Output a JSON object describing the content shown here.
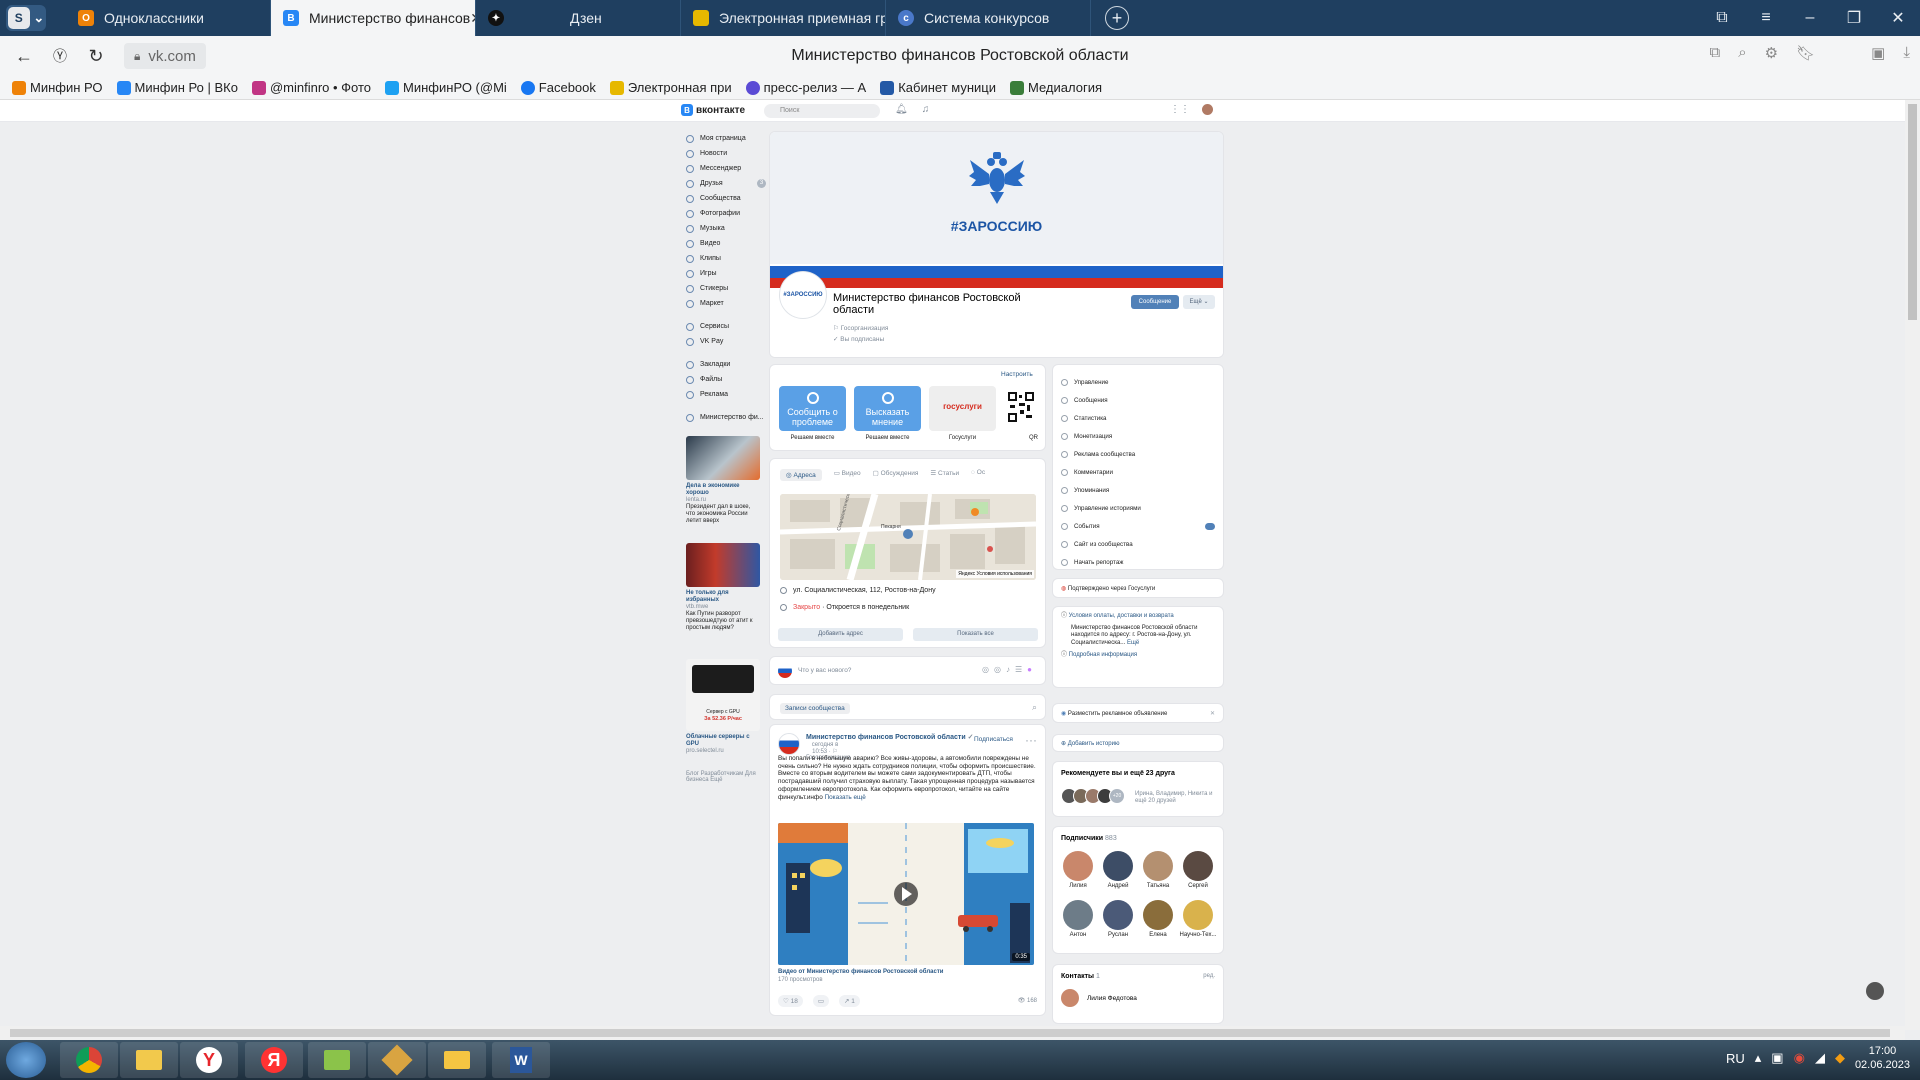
{
  "browser": {
    "tabs": [
      {
        "label": "Одноклассники",
        "icon": "ok-icon",
        "color": "#ee8208"
      },
      {
        "label": "Министерство финансов",
        "icon": "vk-icon",
        "color": "#2787f5",
        "active": true
      },
      {
        "label": "Дзен",
        "icon": "dzen-icon",
        "color": "#111111"
      },
      {
        "label": "Электронная приемная гр",
        "icon": "folder-icon",
        "color": "#e6b800"
      },
      {
        "label": "Система конкурсов",
        "icon": "contest-icon",
        "color": "#4a78c9"
      }
    ],
    "logo_letter": "S",
    "url": "vk.com",
    "page_title": "Министерство финансов Ростовской области",
    "bookmarks": [
      {
        "label": "Минфин РО",
        "color": "#ee8208"
      },
      {
        "label": "Минфин Ро | ВКо",
        "color": "#2787f5"
      },
      {
        "label": "@minfinro • Фото",
        "color": "#c13584"
      },
      {
        "label": "МинфинРО (@Mi",
        "color": "#1da1f2"
      },
      {
        "label": "Facebook",
        "color": "#1877f2"
      },
      {
        "label": "Электронная при",
        "color": "#e6b800"
      },
      {
        "label": "пресс-релиз — А",
        "color": "#5b4bd5"
      },
      {
        "label": "Кабинет муници",
        "color": "#2459a6"
      },
      {
        "label": "Медиалогия",
        "color": "#3a7d3a"
      }
    ]
  },
  "vk": {
    "logo": "вконтакте",
    "search_placeholder": "Поиск",
    "menu": [
      {
        "label": "Моя страница"
      },
      {
        "label": "Новости"
      },
      {
        "label": "Мессенджер"
      },
      {
        "label": "Друзья",
        "badge": "3"
      },
      {
        "label": "Сообщества"
      },
      {
        "label": "Фотографии"
      },
      {
        "label": "Музыка"
      },
      {
        "label": "Видео"
      },
      {
        "label": "Клипы"
      },
      {
        "label": "Игры"
      },
      {
        "label": "Стикеры"
      },
      {
        "label": "Маркет"
      }
    ],
    "menu2": [
      {
        "label": "Сервисы"
      },
      {
        "label": "VK Pay"
      }
    ],
    "menu3": [
      {
        "label": "Закладки"
      },
      {
        "label": "Файлы"
      },
      {
        "label": "Реклама"
      }
    ],
    "menu4": [
      {
        "label": "Министерство фи..."
      }
    ],
    "ads": [
      {
        "title": "Дела в экономике хорошо",
        "domain": "lenta.ru",
        "text": "Президент дал в шоке, что экономика России летит вверх"
      },
      {
        "title": "Не только для избранных",
        "domain": "vtb.mwe",
        "text": "Как Путин разворот превзошедтую от атит к простым людям?"
      },
      {
        "title": "Облачные серверы с GPU",
        "domain": "pro.selectel.ru",
        "text": "",
        "img_line1": "Сервер с GPU",
        "img_line2": "За 52.36 Р/час"
      }
    ],
    "footer_links": "Блог  Разработчикам  Для бизнеса  Ещё"
  },
  "group": {
    "cover_hashtag": "#ЗАРОССИЮ",
    "avatar_text": "#ЗАРОССИЮ",
    "name": "Министерство финансов Ростовской области",
    "type": "Госорганизация",
    "subscribed": "Вы подписаны",
    "btn_message": "Сообщение",
    "btn_more": "Ещё"
  },
  "apps": {
    "settings_link": "Настроить",
    "items": [
      {
        "tile": "Сообщить о проблеме",
        "label": "Решаем вместе",
        "color": "#5aa0e6"
      },
      {
        "tile": "Высказать мнение",
        "label": "Решаем вместе",
        "color": "#5aa0e6"
      },
      {
        "tile": "госуслуги",
        "label": "Госуслуги",
        "color": "#eeeeee"
      },
      {
        "tile": "",
        "label": "QR",
        "color": "#ffffff"
      }
    ]
  },
  "place": {
    "tabs": [
      "Адреса",
      "Видео",
      "Обсуждения",
      "Статьи",
      "Ос"
    ],
    "map_street": "Социалистическая улица",
    "map_poi": "Пекарня",
    "map_credit": "Яндекс  Условия использования",
    "address": "ул. Социалистическая, 112, Ростов-на-Дону",
    "status_closed": "Закрыто",
    "status_open": "· Откроется в понедельник",
    "btn_add": "Добавить адрес",
    "btn_all": "Показать все"
  },
  "newpost": {
    "placeholder": "Что у вас нового?"
  },
  "wall": {
    "tab": "Записи сообщества"
  },
  "post": {
    "author": "Министерство финансов Ростовской области",
    "time": "сегодня в 10:53",
    "type": "Госорганизация",
    "follow": "Подписаться",
    "text": "Вы попали в небольшую аварию? Все живы-здоровы, а автомобили повреждены не очень сильно? Не нужно ждать сотрудников полиции, чтобы оформить происшествие. Вместе со вторым водителем вы можете сами задокументировать ДТП, чтобы пострадавший получил страховую выплату. Такая упрощенная процедура называется оформлением европротокола. Как оформить европротокол, читайте на сайте финкульт.инфо",
    "show_more": "Показать ещё",
    "video_caption": "Видео от Министерство финансов Ростовской области",
    "video_views": "170 просмотров",
    "video_duration": "0:35",
    "likes": "18",
    "comments": "",
    "shares": "1",
    "views": "168"
  },
  "admin_menu": [
    {
      "label": "Управление"
    },
    {
      "label": "Сообщения"
    },
    {
      "label": "Статистика"
    },
    {
      "label": "Монетизация"
    },
    {
      "label": "Реклама сообщества"
    },
    {
      "label": "Комментарии"
    },
    {
      "label": "Упоминания"
    },
    {
      "label": "Управление историями"
    },
    {
      "label": "События",
      "badge": true
    },
    {
      "label": "Сайт из сообщества"
    },
    {
      "label": "Начать репортаж"
    }
  ],
  "gosuslugi_note": "Подтверждено через Госуслуги",
  "info": {
    "payment": "Условия оплаты, доставки и возврата",
    "desc": "Министерство финансов Ростовской области находится по адресу: г. Ростов-на-Дону, ул. Социалистическа...",
    "more": "Ещё",
    "details": "Подробная информация"
  },
  "ad_row": "Разместить рекламное объявление",
  "story_row": "Добавить историю",
  "recommend": {
    "title": "Рекомендуете вы и ещё 23 друга",
    "extra": "+20",
    "desc": "Ирина, Владимир, Никита и ещё 20 друзей"
  },
  "subscribers": {
    "title": "Подписчики",
    "count": "883",
    "people": [
      {
        "name": "Лилия",
        "color": "#c9876b"
      },
      {
        "name": "Андрей",
        "color": "#3d4d66"
      },
      {
        "name": "Татьяна",
        "color": "#b49070"
      },
      {
        "name": "Сергей",
        "color": "#5a4a42"
      },
      {
        "name": "Антон",
        "color": "#6d7c88"
      },
      {
        "name": "Руслан",
        "color": "#4b5a78"
      },
      {
        "name": "Елена",
        "color": "#8a6d3b"
      },
      {
        "name": "Научно-Тех...",
        "color": "#d9b24c"
      }
    ]
  },
  "contacts": {
    "title": "Контакты",
    "count": "1",
    "edit": "ред.",
    "person": "Лилия Федотова"
  },
  "taskbar": {
    "apps": [
      "chrome-icon",
      "explorer-icon",
      "yandex-browser-icon",
      "yandex-icon",
      "folder-icon",
      "network-icon",
      "mail-icon",
      "word-icon"
    ],
    "lang": "RU",
    "time": "17:00",
    "date": "02.06.2023"
  }
}
